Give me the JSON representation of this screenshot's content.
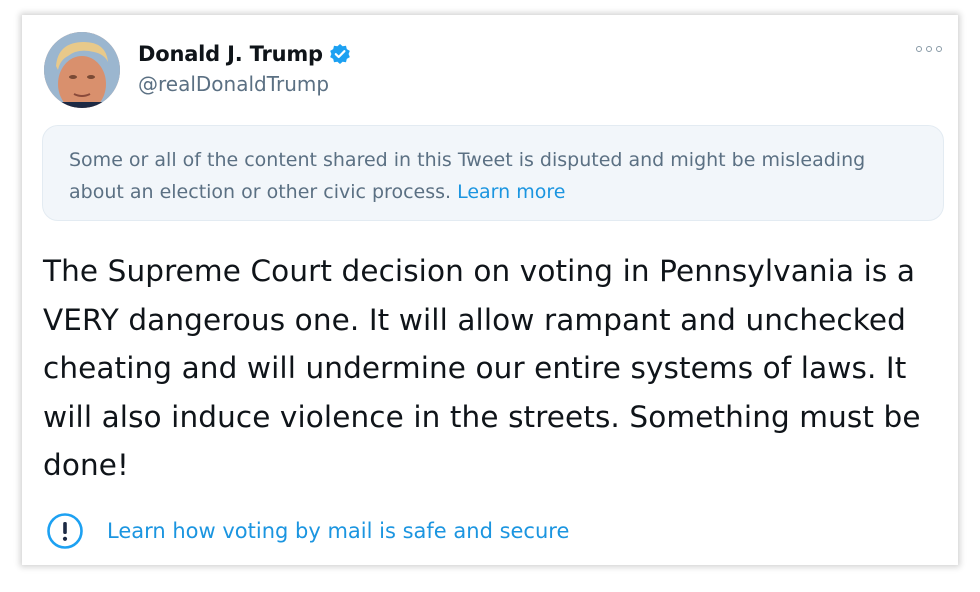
{
  "author": {
    "display_name": "Donald J. Trump",
    "handle": "@realDonaldTrump",
    "verified": true,
    "avatar_icon": "profile-photo",
    "verified_icon": "verified-badge-icon"
  },
  "menu": {
    "icon": "more-options-icon"
  },
  "notice": {
    "text": "Some or all of the content shared in this Tweet is disputed and might be misleading about an election or other civic process.",
    "link_label": "Learn more"
  },
  "tweet": {
    "text": "The Supreme Court decision on voting in Pennsylvania is a VERY dangerous one. It will allow rampant and unchecked cheating and will undermine our entire systems of laws. It will also induce violence in the streets. Something must be done!"
  },
  "info_link": {
    "icon": "exclamation-circle-icon",
    "label": "Learn how voting by mail is safe and secure"
  },
  "colors": {
    "link_blue": "#1b95e0",
    "verified_blue": "#1da1f2",
    "text_dark": "#0f1419",
    "text_muted": "#5b7083",
    "notice_bg": "#f2f6fa"
  }
}
